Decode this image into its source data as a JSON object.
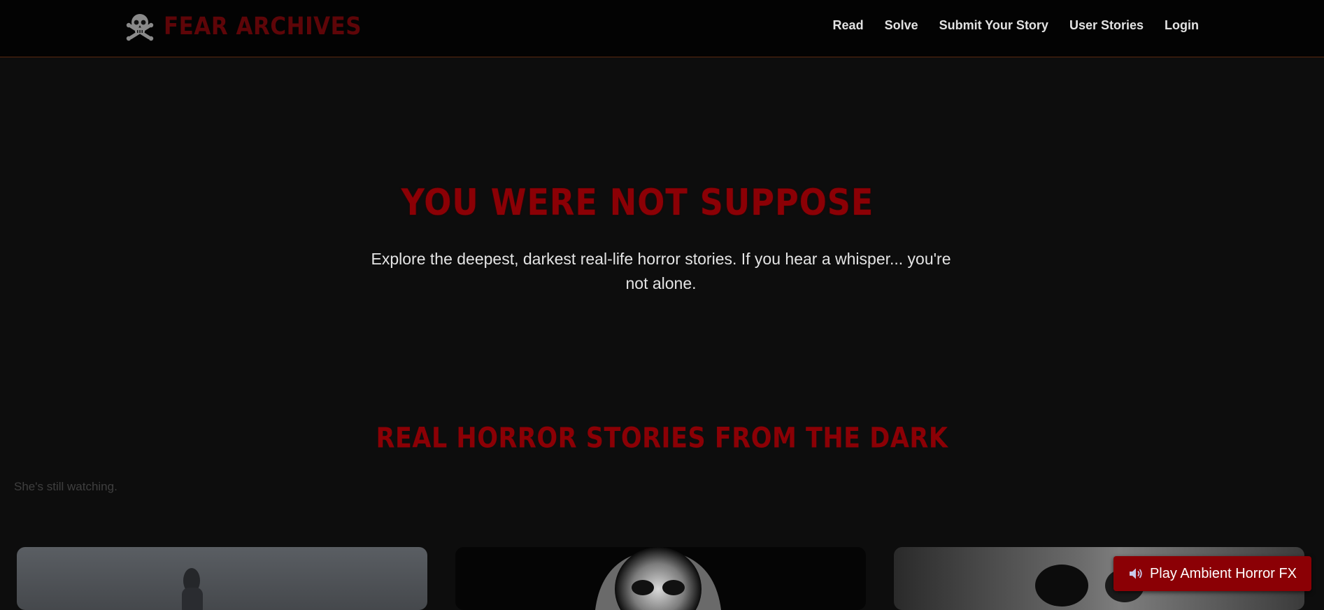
{
  "brand": {
    "name": "FEAR ARCHIVES",
    "icon": "skull-crossbones-icon"
  },
  "nav": {
    "items": [
      {
        "label": "Read"
      },
      {
        "label": "Solve"
      },
      {
        "label": "Submit Your Story"
      },
      {
        "label": "User Stories"
      },
      {
        "label": "Login"
      }
    ]
  },
  "hero": {
    "title": "YOU WERE NOT SUPPOSE",
    "subtitle": "Explore the deepest, darkest real-life horror stories. If you hear a whisper... you're not alone."
  },
  "stories": {
    "heading": "REAL HORROR STORIES FROM THE DARK",
    "whisper": "She's still watching."
  },
  "ambient_button": {
    "label": "Play Ambient Horror FX",
    "icon": "speaker-icon"
  },
  "colors": {
    "accent": "#8b0005",
    "background": "#0d0d0d",
    "navbar": "#030303"
  }
}
